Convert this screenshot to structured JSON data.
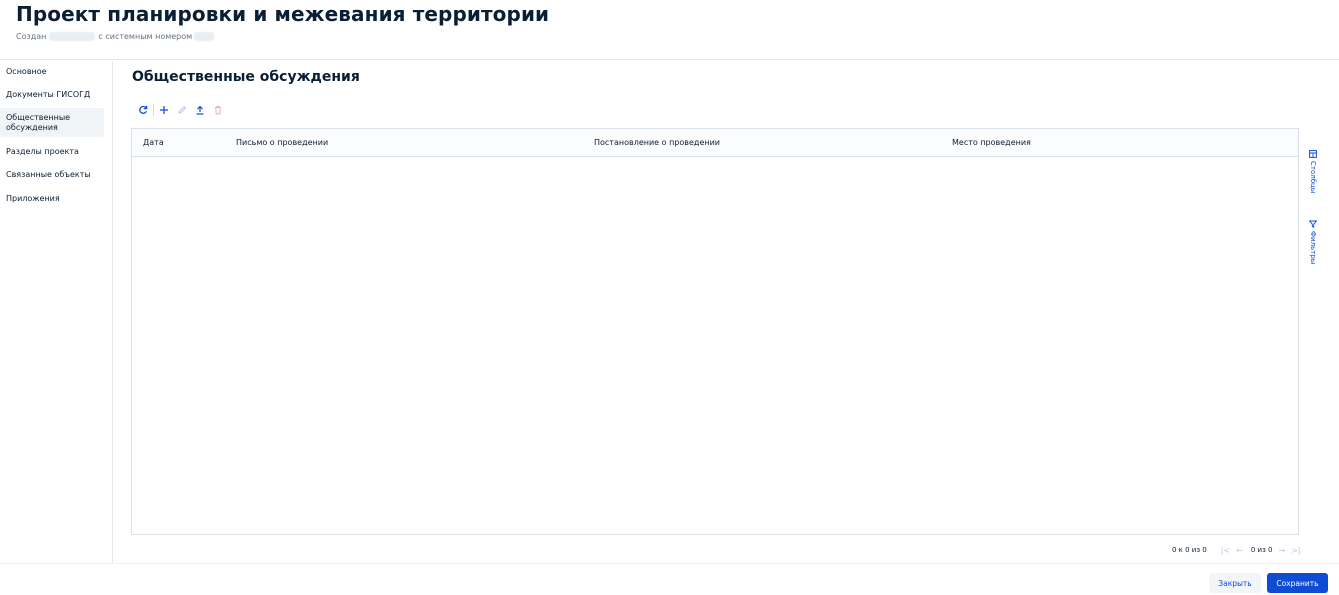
{
  "header": {
    "title": "Проект планировки и межевания территории",
    "created_label": "Создан",
    "sysnum_label": "с системным номером"
  },
  "sidebar": {
    "items": [
      {
        "label": "Основное"
      },
      {
        "label": "Документы ГИСОГД"
      },
      {
        "label": "Общественные обсуждения",
        "active": true
      },
      {
        "label": "Разделы проекта"
      },
      {
        "label": "Связанные объекты"
      },
      {
        "label": "Приложения"
      }
    ]
  },
  "main": {
    "section_title": "Общественные обсуждения",
    "toolbar": {
      "icons": [
        "refresh-icon",
        "plus-icon",
        "pencil-icon",
        "upload-icon",
        "trash-icon"
      ]
    },
    "table": {
      "columns": [
        "Дата",
        "Письмо о проведении",
        "Постановление о проведении",
        "Место проведения"
      ],
      "rows": []
    },
    "side_panel": {
      "columns_label": "Столбцы",
      "filters_label": "Фильтры"
    },
    "pager": {
      "range": "0 к 0 из 0",
      "page": "0 из 0"
    }
  },
  "footer": {
    "close_label": "Закрыть",
    "save_label": "Сохранить"
  },
  "colors": {
    "primary": "#0d4cd3",
    "text": "#0b1f33",
    "danger_disabled": "#f3a8b0",
    "border": "#d9e0e7"
  }
}
